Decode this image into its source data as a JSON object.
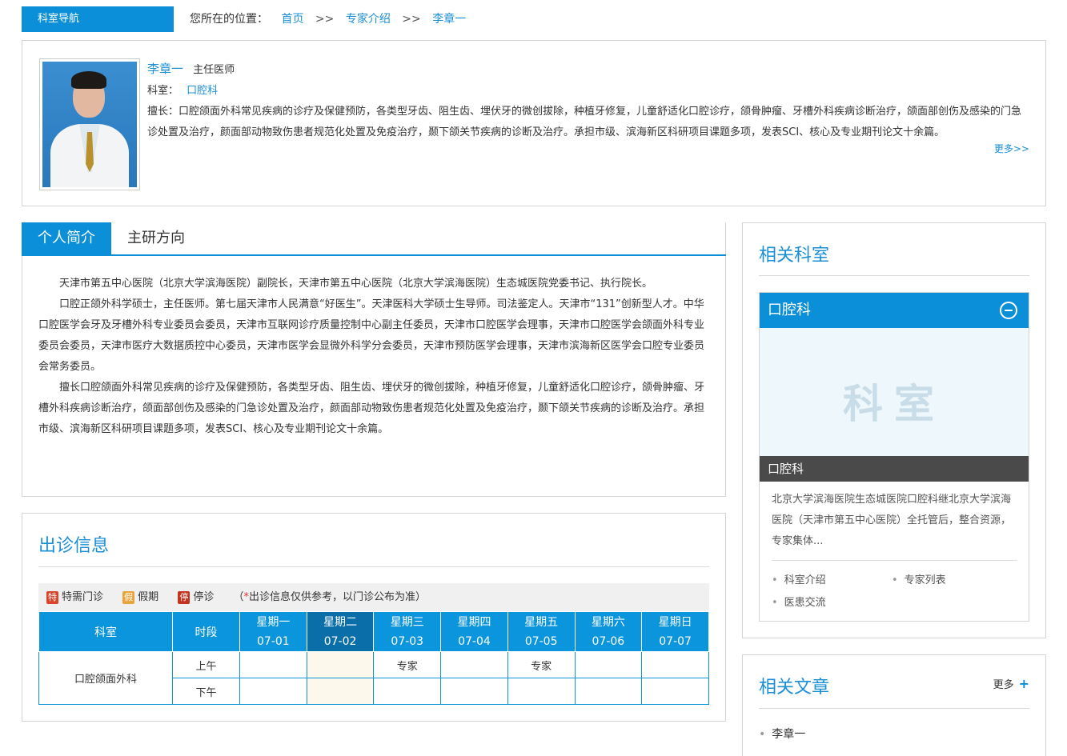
{
  "top": {
    "nav_tab": "科室导航",
    "location_label": "您所在的位置：",
    "crumbs": [
      "首页",
      "专家介绍",
      "李章一"
    ],
    "sep": ">>"
  },
  "doctor": {
    "name": "李章一",
    "title": "主任医师",
    "dept_label": "科室：",
    "dept": "口腔科",
    "specialty_label": "擅长：",
    "specialty": "口腔颌面外科常见疾病的诊疗及保健预防，各类型牙齿、阻生齿、埋伏牙的微创拔除，种植牙修复，儿童舒适化口腔诊疗，颌骨肿瘤、牙槽外科疾病诊断治疗，颌面部创伤及感染的门急诊处置及治疗，颜面部动物致伤患者规范化处置及免疫治疗，颞下颌关节疾病的诊断及治疗。承担市级、滨海新区科研项目课题多项，发表SCI、核心及专业期刊论文十余篇。",
    "more": "更多>>"
  },
  "tabs": {
    "profile": "个人简介",
    "research": "主研方向"
  },
  "profile": {
    "p1": "天津市第五中心医院（北京大学滨海医院）副院长，天津市第五中心医院（北京大学滨海医院）生态城医院党委书记、执行院长。",
    "p2": "口腔正颌外科学硕士，主任医师。第七届天津市人民满意“好医生”。天津医科大学硕士生导师。司法鉴定人。天津市“131”创新型人才。中华口腔医学会牙及牙槽外科专业委员会委员，天津市互联网诊疗质量控制中心副主任委员，天津市口腔医学会理事，天津市口腔医学会颌面外科专业委员会委员，天津市医疗大数据质控中心委员，天津市医学会显微外科学分会委员，天津市预防医学会理事，天津市滨海新区医学会口腔专业委员会常务委员。",
    "p3": "擅长口腔颌面外科常见疾病的诊疗及保健预防，各类型牙齿、阻生齿、埋伏牙的微创拔除，种植牙修复，儿童舒适化口腔诊疗，颌骨肿瘤、牙槽外科疾病诊断治疗，颌面部创伤及感染的门急诊处置及治疗，颜面部动物致伤患者规范化处置及免疫治疗，颞下颌关节疾病的诊断及治疗。承担市级、滨海新区科研项目课题多项，发表SCI、核心及专业期刊论文十余篇。"
  },
  "schedule": {
    "title": "出诊信息",
    "legend": {
      "special_badge": "特",
      "special": "特需门诊",
      "holiday_badge": "假",
      "holiday": "假期",
      "stop_badge": "停",
      "stop": "停诊",
      "note_open": "（",
      "note_star": "*",
      "note": "出诊信息仅供参考，以门诊公布为准）"
    },
    "col_dept": "科室",
    "col_period": "时段",
    "days": [
      {
        "name": "星期一",
        "date": "07-01"
      },
      {
        "name": "星期二",
        "date": "07-02"
      },
      {
        "name": "星期三",
        "date": "07-03"
      },
      {
        "name": "星期四",
        "date": "07-04"
      },
      {
        "name": "星期五",
        "date": "07-05"
      },
      {
        "name": "星期六",
        "date": "07-06"
      },
      {
        "name": "星期日",
        "date": "07-07"
      }
    ],
    "dept": "口腔颌面外科",
    "morning": "上午",
    "afternoon": "下午",
    "morning_cells": [
      "",
      "",
      "专家",
      "",
      "专家",
      "",
      ""
    ],
    "afternoon_cells": [
      "",
      "",
      "",
      "",
      "",
      "",
      ""
    ],
    "colors": {
      "header": "#0b95dc",
      "today": "#0a6ea8"
    }
  },
  "related_dept": {
    "title": "相关科室",
    "name": "口腔科",
    "watermark": "科室",
    "caption": "口腔科",
    "desc": "北京大学滨海医院生态城医院口腔科继北京大学滨海医院（天津市第五中心医院）全托管后，整合资源，专家集体...",
    "links": [
      "科室介绍",
      "专家列表",
      "医患交流"
    ]
  },
  "related_articles": {
    "title": "相关文章",
    "more": "更多",
    "items": [
      "李章一"
    ]
  },
  "theme": {
    "accent": "#0b8fd8",
    "link": "#1b8fd6"
  }
}
